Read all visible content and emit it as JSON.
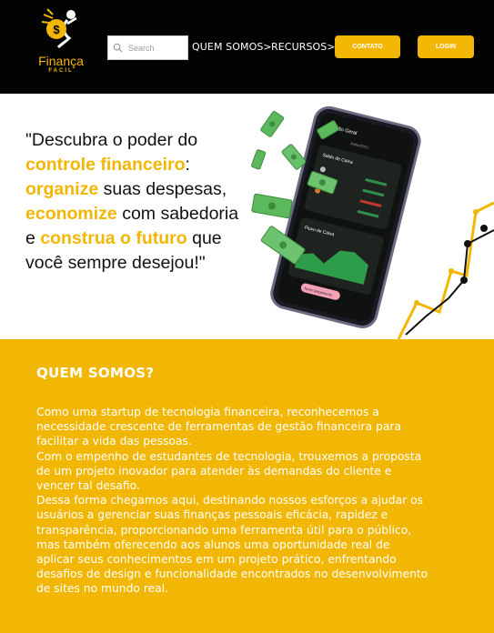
{
  "header": {
    "logo": {
      "name": "Finança",
      "tagline": "FACIL"
    },
    "search": {
      "placeholder": "Search",
      "icon": "search-icon"
    },
    "nav": [
      {
        "label": "QUEM SOMOS>"
      },
      {
        "label": "RECURSOS>"
      }
    ],
    "buttons": {
      "contato": "CONTATO",
      "login": "LOGIN"
    }
  },
  "hero": {
    "line1": "\"Descubra o poder do",
    "hl1": "controle financeiro",
    "after_hl1": ":",
    "hl2": "organize",
    "after_hl2": " suas despesas,",
    "hl3": "economize",
    "after_hl3": " com sabedoria",
    "before_hl4": "e ",
    "hl4": "construa o futuro",
    "after_hl4": " que",
    "last_line": "você sempre desejou!\"",
    "phone": {
      "header": "Visão Geral",
      "month": "Junho/2021",
      "card1_title": "Saldo de Caixa",
      "card2_title": "Fluxo de Caixa",
      "row_labels": [
        "2021",
        "Real",
        "Débito",
        "Total"
      ],
      "total_label": "Total",
      "button": "Novo lançamento"
    }
  },
  "about": {
    "title": "QUEM SOMOS?",
    "paragraphs": [
      "Como uma startup de tecnologia financeira, reconhecemos a necessidade crescente de ferramentas de gestão financeira para facilitar a vida das pessoas.",
      "Com o empenho de estudantes de tecnologia, trouxemos a proposta de um projeto inovador para atender às demandas do cliente e vencer tal desafio.",
      "Dessa forma chegamos aqui, destinando nossos esforços a ajudar os usuários a gerenciar suas finanças pessoais eficácia, rapidez e transparência, proporcionando uma ferramenta útil para o público, mas também oferecendo aos alunos uma oportunidade real de aplicar seus conhecimentos em um projeto prático, enfrentando desafios de design e funcionalidade encontrados no desenvolvimento de sites no mundo real."
    ]
  },
  "colors": {
    "accent": "#f2b705",
    "header_bg": "#030303",
    "text_dark": "#111111",
    "white": "#ffffff"
  }
}
